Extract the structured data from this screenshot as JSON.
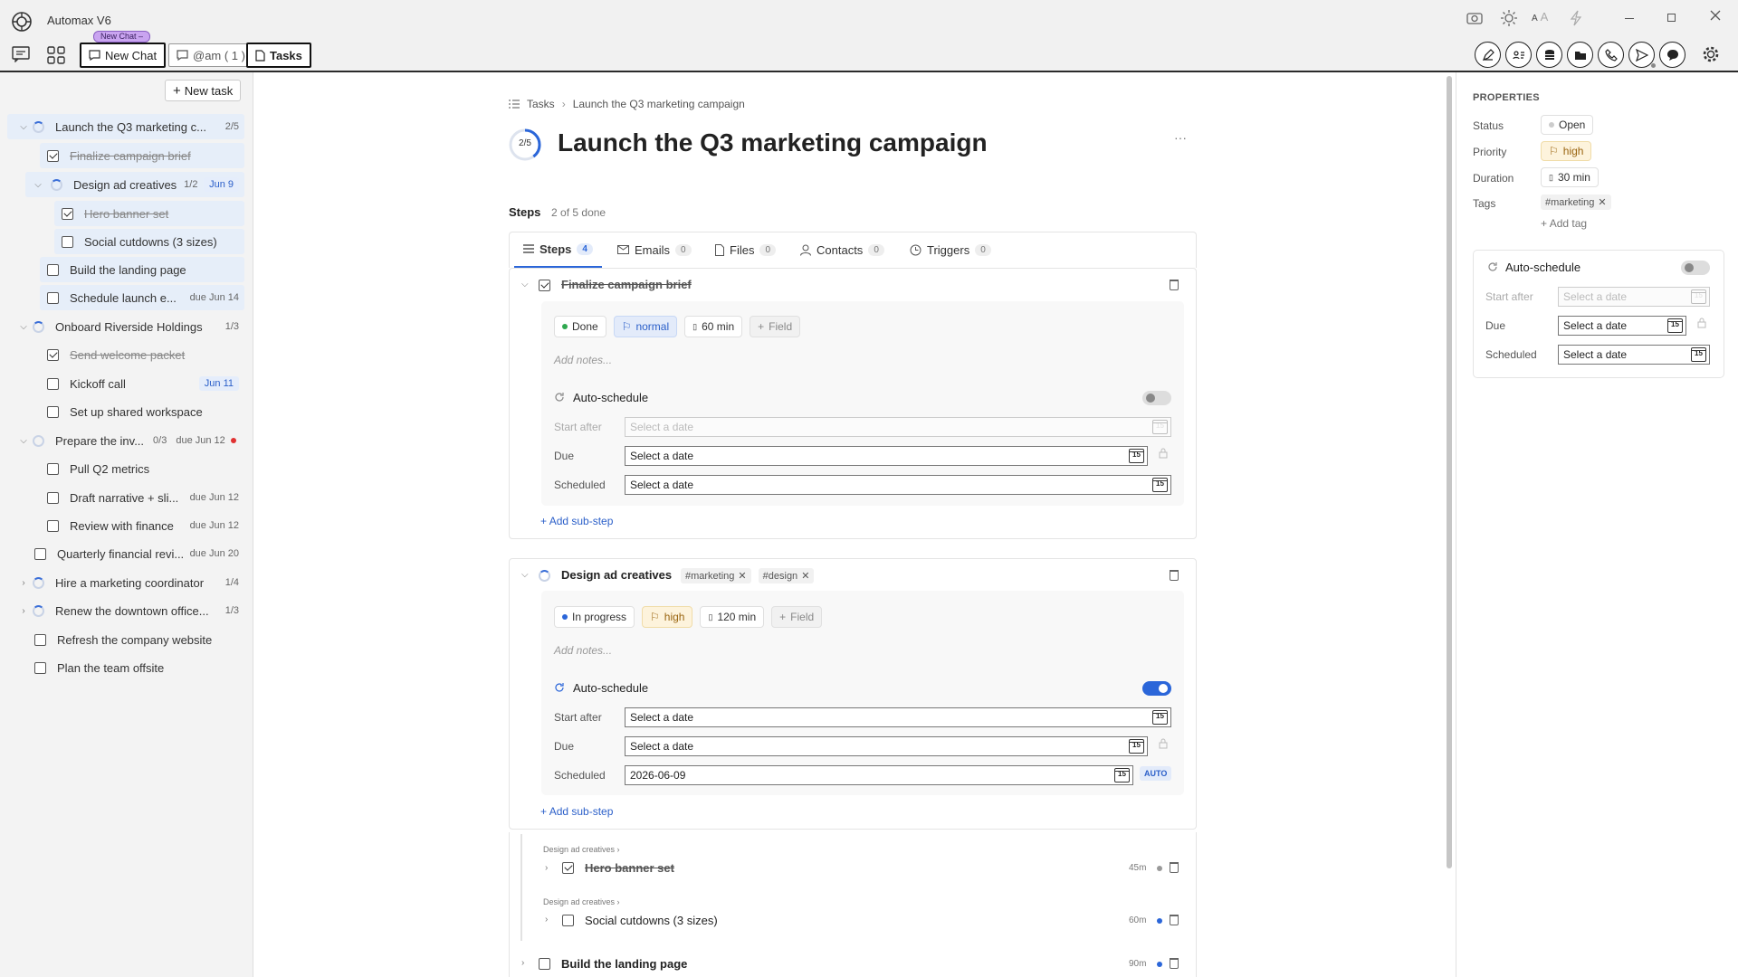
{
  "app": {
    "title": "Automax V6"
  },
  "toolbar": {
    "new_chat_badge": "New Chat",
    "new_chat": "New Chat",
    "mention": "@am ( 1 )",
    "tasks": "Tasks"
  },
  "sidebar": {
    "new_task": "New task",
    "items": [
      {
        "label": "Launch the Q3 marketing c...",
        "meta": "2/5"
      },
      {
        "label": "Finalize campaign brief"
      },
      {
        "label": "Design ad creatives",
        "meta": "1/2",
        "date": "Jun 9"
      },
      {
        "label": "Hero banner set"
      },
      {
        "label": "Social cutdowns (3 sizes)"
      },
      {
        "label": "Build the landing page"
      },
      {
        "label": "Schedule launch e...",
        "meta": "due Jun 14"
      },
      {
        "label": "Onboard Riverside Holdings",
        "meta": "1/3"
      },
      {
        "label": "Send welcome packet"
      },
      {
        "label": "Kickoff call",
        "date": "Jun 11"
      },
      {
        "label": "Set up shared workspace"
      },
      {
        "label": "Prepare the inv...",
        "meta1": "0/3",
        "meta2": "due Jun 12"
      },
      {
        "label": "Pull Q2 metrics"
      },
      {
        "label": "Draft narrative + sli...",
        "meta": "due Jun 12"
      },
      {
        "label": "Review with finance",
        "meta": "due Jun 12"
      },
      {
        "label": "Quarterly financial revi...",
        "meta": "due Jun 20"
      },
      {
        "label": "Hire a marketing coordinator",
        "meta": "1/4"
      },
      {
        "label": "Renew the downtown office...",
        "meta": "1/3"
      },
      {
        "label": "Refresh the company website"
      },
      {
        "label": "Plan the team offsite"
      }
    ]
  },
  "main": {
    "breadcrumb": [
      "Tasks",
      "Launch the Q3 marketing campaign"
    ],
    "progress": "2/5",
    "progress_fraction": 0.4,
    "title": "Launch the Q3 marketing campaign",
    "more": "···",
    "steps_heading": "Steps",
    "steps_count": "2 of 5 done",
    "tabs": [
      {
        "label": "Steps",
        "count": "4"
      },
      {
        "label": "Emails",
        "count": "0"
      },
      {
        "label": "Files",
        "count": "0"
      },
      {
        "label": "Contacts",
        "count": "0"
      },
      {
        "label": "Triggers",
        "count": "0"
      }
    ],
    "step1": {
      "title": "Finalize campaign brief",
      "status": "Done",
      "priority": "normal",
      "duration": "60 min",
      "field": "Field",
      "notes": "Add notes...",
      "auto": "Auto-schedule",
      "start_after": "Start after",
      "start_ph": "Select a date",
      "due": "Due",
      "due_ph": "Select a date",
      "scheduled": "Scheduled",
      "sched_ph": "Select a date",
      "add_sub": "Add sub-step"
    },
    "step2": {
      "title": "Design ad creatives",
      "tags": [
        "#marketing",
        "#design"
      ],
      "status": "In progress",
      "priority": "high",
      "duration": "120 min",
      "field": "Field",
      "notes": "Add notes...",
      "auto": "Auto-schedule",
      "start_after": "Start after",
      "start_ph": "Select a date",
      "due": "Due",
      "due_ph": "Select a date",
      "scheduled": "Scheduled",
      "sched_val": "2026-06-09",
      "auto_badge": "AUTO",
      "add_sub": "Add sub-step"
    },
    "substeps": [
      {
        "parent": "Design ad creatives ›",
        "title": "Hero banner set",
        "time": "45m"
      },
      {
        "parent": "Design ad creatives ›",
        "title": "Social cutdowns (3 sizes)",
        "time": "60m"
      }
    ],
    "step3": {
      "title": "Build the landing page",
      "time": "90m"
    },
    "cal_day": "15"
  },
  "properties": {
    "heading": "PROPERTIES",
    "status_lbl": "Status",
    "status": "Open",
    "priority_lbl": "Priority",
    "priority": "high",
    "duration_lbl": "Duration",
    "duration": "30 min",
    "tags_lbl": "Tags",
    "tag": "#marketing",
    "add_tag": "Add tag",
    "auto": "Auto-schedule",
    "start_after": "Start after",
    "start_ph": "Select a date",
    "due": "Due",
    "due_ph": "Select a date",
    "scheduled": "Scheduled",
    "sched_ph": "Select a date"
  },
  "colors": {
    "accent": "#2b66d9",
    "high": "#b7791f",
    "done": "#2fa84f",
    "progress": "#2b66d9",
    "red_dot": "#e03131"
  }
}
